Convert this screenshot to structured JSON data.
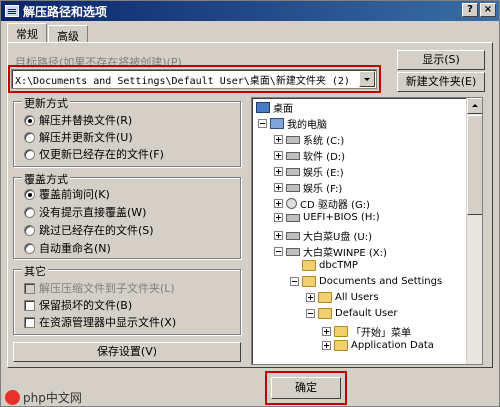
{
  "window": {
    "title": "解压路径和选项",
    "help_label": "?",
    "close_label": "×"
  },
  "tabs": [
    {
      "label": "常规"
    },
    {
      "label": "高级"
    }
  ],
  "path": {
    "label": "目标路径(如果不存在将被创建)(P)",
    "value": "X:\\Documents and Settings\\Default User\\桌面\\新建文件夹 (2)"
  },
  "buttons": {
    "show": "显示(S)",
    "new_folder": "新建文件夹(E)",
    "save_settings": "保存设置(V)",
    "ok": "确定"
  },
  "update_mode": {
    "title": "更新方式",
    "options": [
      {
        "label": "解压并替换文件(R)",
        "selected": true
      },
      {
        "label": "解压并更新文件(U)",
        "selected": false
      },
      {
        "label": "仅更新已经存在的文件(F)",
        "selected": false
      }
    ]
  },
  "overwrite_mode": {
    "title": "覆盖方式",
    "options": [
      {
        "label": "覆盖前询问(K)",
        "selected": true
      },
      {
        "label": "没有提示直接覆盖(W)",
        "selected": false
      },
      {
        "label": "跳过已经存在的文件(S)",
        "selected": false
      },
      {
        "label": "自动重命名(N)",
        "selected": false
      }
    ]
  },
  "misc": {
    "title": "其它",
    "options": [
      {
        "label": "解压压缩文件到子文件夹(L)",
        "disabled": true
      },
      {
        "label": "保留损坏的文件(B)",
        "disabled": false
      },
      {
        "label": "在资源管理器中显示文件(X)",
        "disabled": false
      }
    ]
  },
  "tree": [
    {
      "label": "桌面",
      "icon": "desktop-icon"
    },
    {
      "label": "我的电脑",
      "icon": "computer-icon"
    },
    {
      "label": "系统 (C:)",
      "icon": "drive-icon"
    },
    {
      "label": "软件 (D:)",
      "icon": "drive-icon"
    },
    {
      "label": "娱乐 (E:)",
      "icon": "drive-icon"
    },
    {
      "label": "娱乐 (F:)",
      "icon": "drive-icon"
    },
    {
      "label": "CD 驱动器 (G:)",
      "icon": "cd-drive-icon"
    },
    {
      "label": "UEFI+BIOS (H:)",
      "icon": "drive-icon"
    },
    {
      "label": "大白菜U盘 (U:)",
      "icon": "drive-icon"
    },
    {
      "label": "大白菜WINPE (X:)",
      "icon": "drive-icon"
    },
    {
      "label": "dbcTMP",
      "icon": "folder-icon"
    },
    {
      "label": "Documents and Settings",
      "icon": "folder-icon"
    },
    {
      "label": "All Users",
      "icon": "folder-icon"
    },
    {
      "label": "Default User",
      "icon": "folder-icon"
    },
    {
      "label": "「开始」菜单",
      "icon": "folder-icon"
    },
    {
      "label": "Application Data",
      "icon": "folder-icon"
    }
  ],
  "watermark": {
    "text": "php中文网",
    "logo": "php"
  },
  "colors": {
    "highlight_border": "#c00000",
    "titlebar": "#0a246a",
    "face": "#d4d0c8"
  }
}
